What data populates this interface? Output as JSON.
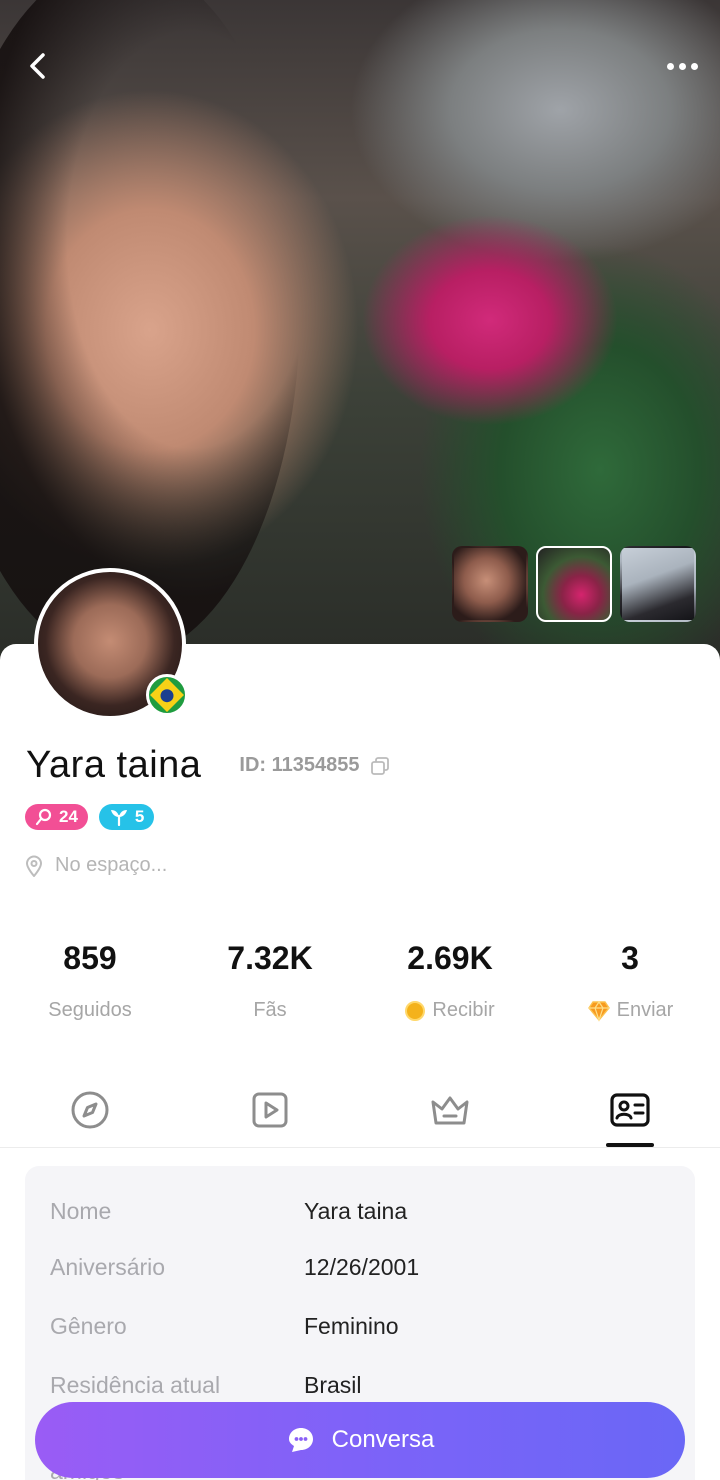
{
  "profile": {
    "name": "Yara taina",
    "id_label": "ID: 11354855",
    "level_badge": "24",
    "rank_badge": "5",
    "location": "No espaço..."
  },
  "stats": [
    {
      "value": "859",
      "label": "Seguidos"
    },
    {
      "value": "7.32K",
      "label": "Fãs"
    },
    {
      "value": "2.69K",
      "label": "Recibir"
    },
    {
      "value": "3",
      "label": "Enviar"
    }
  ],
  "tabs": [
    {
      "icon": "compass-icon"
    },
    {
      "icon": "play-icon"
    },
    {
      "icon": "crown-icon"
    },
    {
      "icon": "id-card-icon",
      "active": true
    }
  ],
  "info": {
    "rows": [
      {
        "key": "Nome",
        "value": "Yara taina"
      },
      {
        "key": "Aniversário",
        "value": "12/26/2001"
      },
      {
        "key": "Gênero",
        "value": "Feminino"
      },
      {
        "key": "Residência atual",
        "value": "Brasil"
      }
    ],
    "partial_row_label": "amigos"
  },
  "chat_button": {
    "label": "Conversa"
  },
  "colors": {
    "accent_gradient_start": "#9a5cf5",
    "accent_gradient_end": "#6a67f6",
    "level_badge": "#f24f95",
    "rank_badge": "#26c2e8"
  }
}
